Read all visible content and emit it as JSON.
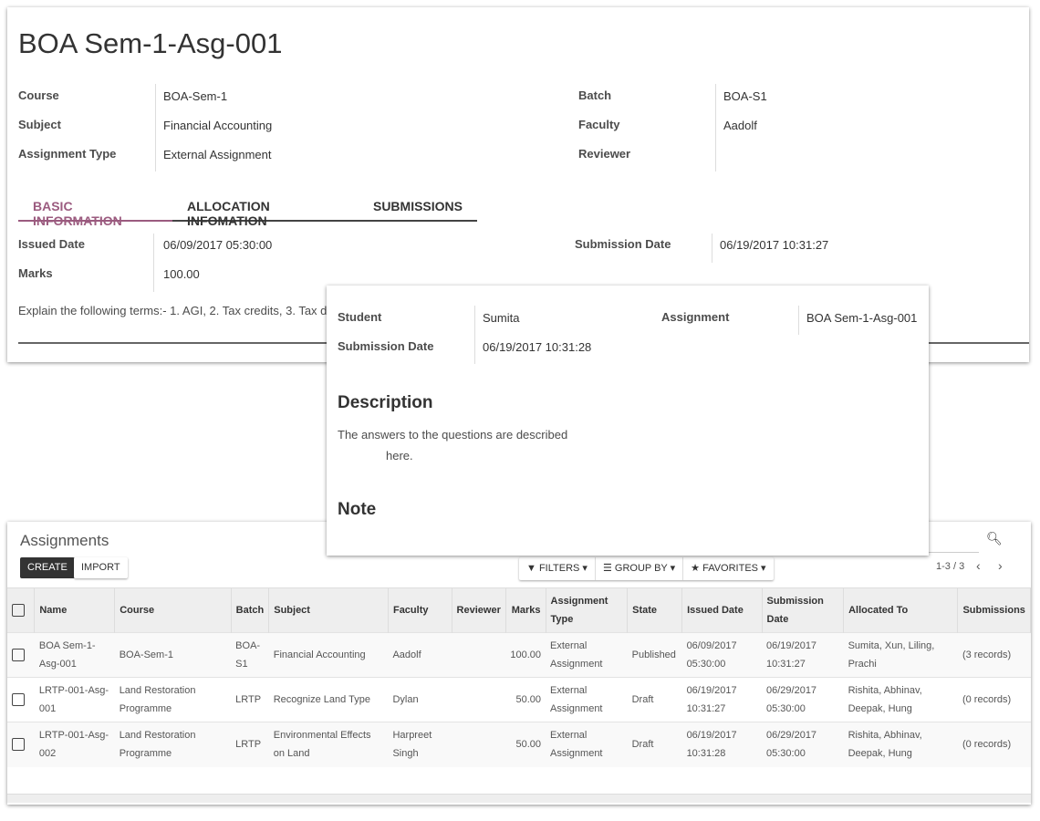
{
  "form": {
    "title": "BOA Sem-1-Asg-001",
    "left_fields": [
      {
        "label": "Course",
        "value": "BOA-Sem-1"
      },
      {
        "label": "Subject",
        "value": "Financial Accounting"
      },
      {
        "label": "Assignment Type",
        "value": "External Assignment"
      }
    ],
    "right_fields": [
      {
        "label": "Batch",
        "value": "BOA-S1"
      },
      {
        "label": "Faculty",
        "value": "Aadolf"
      },
      {
        "label": "Reviewer",
        "value": ""
      }
    ],
    "tabs": [
      {
        "label": "BASIC INFORMATION",
        "active": true
      },
      {
        "label": "ALLOCATION INFOMATION"
      },
      {
        "label": "SUBMISSIONS"
      }
    ],
    "issued_date": {
      "label": "Issued Date",
      "value": "06/09/2017 05:30:00"
    },
    "marks": {
      "label": "Marks",
      "value": "100.00"
    },
    "submission_date": {
      "label": "Submission Date",
      "value": "06/19/2017 10:31:27"
    },
    "description": "Explain the following terms:- 1. AGI, 2. Tax credits, 3. Tax d",
    "accent_color": "#9b5b7f"
  },
  "submission": {
    "student": {
      "label": "Student",
      "value": "Sumita"
    },
    "submission_date": {
      "label": "Submission Date",
      "value": "06/19/2017 10:31:28"
    },
    "assignment": {
      "label": "Assignment",
      "value": "BOA Sem-1-Asg-001"
    },
    "description_heading": "Description",
    "description_line1": "The answers to the questions are described",
    "description_line2": "here.",
    "note_heading": "Note"
  },
  "list": {
    "title": "Assignments",
    "create_label": "CREATE",
    "import_label": "IMPORT",
    "filters_label": "FILTERS",
    "group_by_label": "GROUP BY",
    "favorites_label": "FAVORITES",
    "pager": "1-3 / 3",
    "columns": [
      "Name",
      "Course",
      "Batch",
      "Subject",
      "Faculty",
      "Reviewer",
      "Marks",
      "Assignment Type",
      "State",
      "Issued Date",
      "Submission Date",
      "Allocated To",
      "Submissions"
    ],
    "rows": [
      [
        "BOA Sem-1-Asg-001",
        "BOA-Sem-1",
        "BOA-S1",
        "Financial Accounting",
        "Aadolf",
        "",
        "100.00",
        "External Assignment",
        "Published",
        "06/09/2017 05:30:00",
        "06/19/2017 10:31:27",
        "Sumita, Xun, Liling, Prachi",
        "(3 records)"
      ],
      [
        "LRTP-001-Asg-001",
        "Land Restoration Programme",
        "LRTP",
        "Recognize Land Type",
        "Dylan",
        "",
        "50.00",
        "External Assignment",
        "Draft",
        "06/19/2017 10:31:27",
        "06/29/2017 05:30:00",
        "Rishita, Abhinav, Deepak, Hung",
        "(0 records)"
      ],
      [
        "LRTP-001-Asg-002",
        "Land Restoration Programme",
        "LRTP",
        "Environmental Effects on Land",
        "Harpreet Singh",
        "",
        "50.00",
        "External Assignment",
        "Draft",
        "06/19/2017 10:31:28",
        "06/29/2017 05:30:00",
        "Rishita, Abhinav, Deepak, Hung",
        "(0 records)"
      ]
    ]
  }
}
